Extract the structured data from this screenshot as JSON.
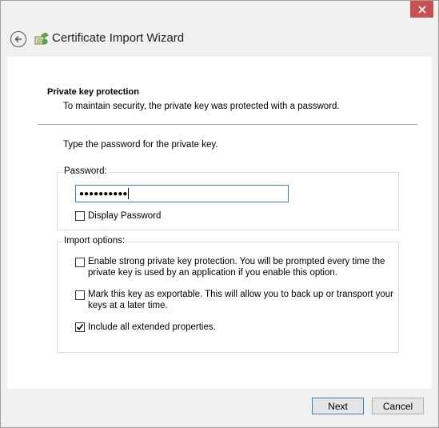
{
  "window": {
    "close_icon": "close-icon",
    "accent_close": "#c75050"
  },
  "header": {
    "back_icon": "back-arrow-icon",
    "wizard_icon": "certificate-icon",
    "title": "Certificate Import Wizard"
  },
  "page": {
    "section_title": "Private key protection",
    "section_desc": "To maintain security, the private key was protected with a password.",
    "instruction": "Type the password for the private key."
  },
  "password_group": {
    "label": "Password:",
    "value": "●●●●●●●●●●",
    "display_password_label": "Display Password",
    "display_password_checked": false
  },
  "import_options": {
    "label": "Import options:",
    "options": [
      {
        "line1": "Enable strong private key protection. You will be prompted every time the",
        "line2": "private key is used by an application if you enable this option.",
        "checked": false
      },
      {
        "line1": "Mark this key as exportable. This will allow you to back up or transport your",
        "line2": "keys at a later time.",
        "checked": false
      },
      {
        "line1": "Include all extended properties.",
        "line2": "",
        "checked": true
      }
    ]
  },
  "footer": {
    "next_label": "Next",
    "cancel_label": "Cancel"
  }
}
